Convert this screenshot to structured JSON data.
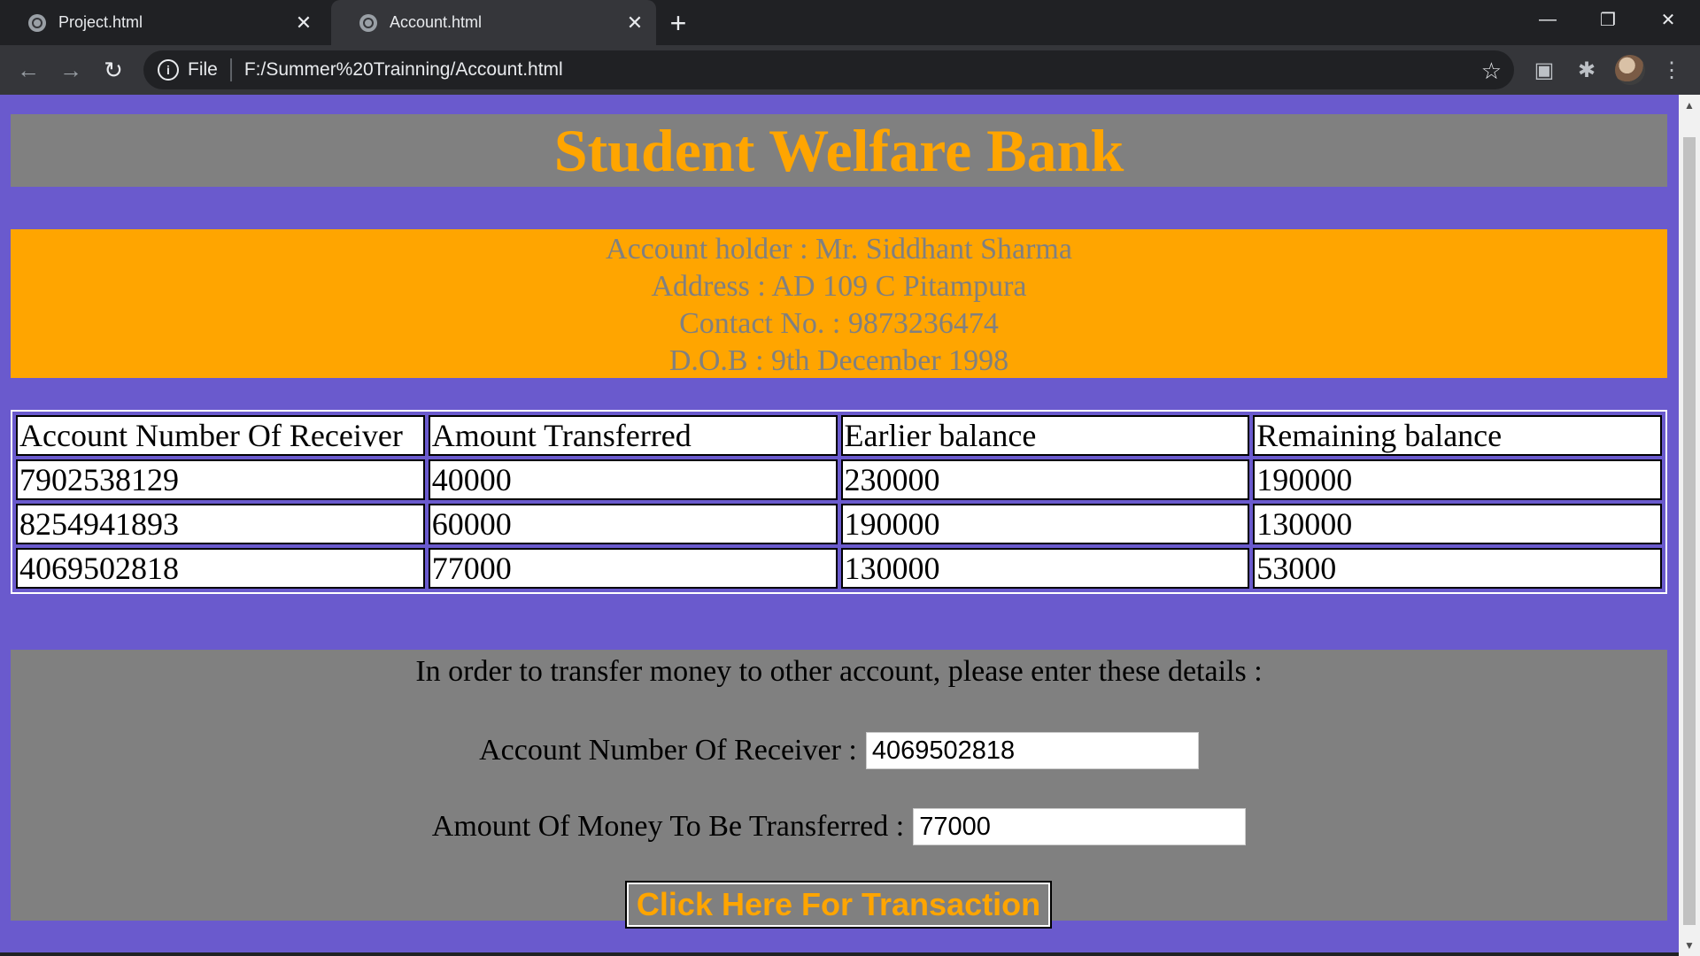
{
  "browser": {
    "tabs": [
      {
        "title": "Project.html",
        "active": false
      },
      {
        "title": "Account.html",
        "active": true
      }
    ],
    "new_tab_icon": "plus-icon",
    "address": {
      "scheme_label": "File",
      "url": "F:/Summer%20Trainning/Account.html"
    }
  },
  "page": {
    "title": "Student Welfare Bank",
    "holder": {
      "name_line": "Account holder : Mr. Siddhant Sharma",
      "address_line": "Address : AD 109 C Pitampura",
      "contact_line": "Contact No. : 9873236474",
      "dob_line": "D.O.B : 9th December 1998"
    },
    "table": {
      "headers": [
        "Account Number Of Receiver",
        "Amount Transferred",
        "Earlier balance",
        "Remaining balance"
      ],
      "rows": [
        [
          "7902538129",
          "40000",
          "230000",
          "190000"
        ],
        [
          "8254941893",
          "60000",
          "190000",
          "130000"
        ],
        [
          "4069502818",
          "77000",
          "130000",
          "53000"
        ]
      ]
    },
    "form": {
      "intro": "In order to transfer money to other account, please enter these details :",
      "receiver_label": "Account Number Of Receiver :",
      "receiver_value": "4069502818",
      "amount_label": "Amount Of Money To Be Transferred :",
      "amount_value": "77000",
      "button_label": "Click Here For Transaction"
    },
    "colors": {
      "background": "#6a5acd",
      "title_bg": "#808080",
      "title_text": "#ffa500",
      "holder_bg": "#ffa500",
      "holder_text": "#808080"
    }
  }
}
